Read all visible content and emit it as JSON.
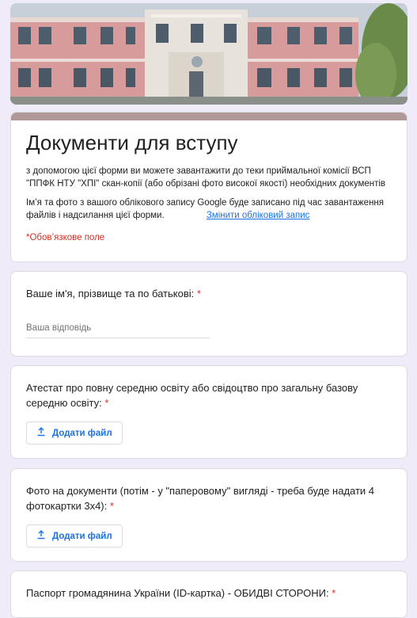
{
  "form": {
    "title": "Документи для вступу",
    "description": "з допомогою цієї форми ви можете завантажити до теки приймальної комісії ВСП \"ППФК НТУ \"ХПІ\" скан-копії (або обрізані фото високої якості) необхідних документів",
    "account_note": "Ім’я та фото з вашого облікового запису Google буде записано під час завантаження файлів і надсилання цієї форми.",
    "switch_account": "Змінити обліковий запис",
    "required_note": "*Обов’язкове поле"
  },
  "questions": [
    {
      "title": "Ваше ім'я, прізвище та по батькові:",
      "required": "*",
      "placeholder": "Ваша відповідь"
    },
    {
      "title": "Атестат про повну середню освіту або свідоцтво про загальну базову середню освіту:",
      "required": "*",
      "button": "Додати файл"
    },
    {
      "title": "Фото на документи (потім - у \"паперовому\" вигляді - треба буде надати 4 фотокартки 3х4):",
      "required": "*",
      "button": "Додати файл"
    },
    {
      "title": "Паспорт громадянина України (ID-картка) - ОБИДВІ СТОРОНИ:",
      "required": "*"
    }
  ],
  "colors": {
    "accent": "#1a73e8",
    "required": "#d93025",
    "header_bar": "#b09896",
    "background": "#f0ebf8"
  },
  "icons": {
    "upload": "upload-icon"
  }
}
